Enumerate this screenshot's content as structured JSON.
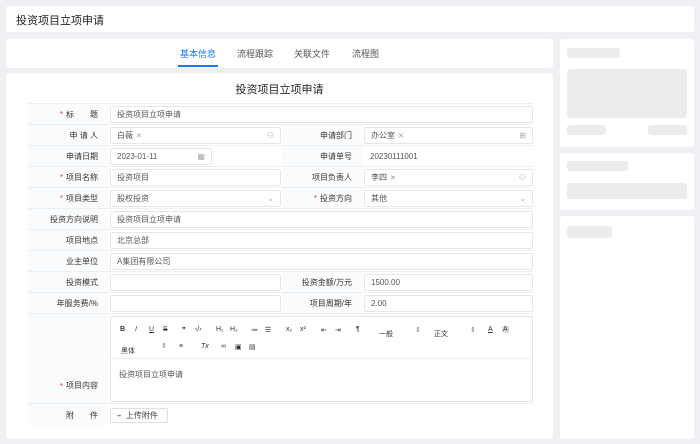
{
  "page": {
    "title": "投资项目立项申请"
  },
  "tabs": [
    {
      "label": "基本信息",
      "active": true
    },
    {
      "label": "流程跟踪",
      "active": false
    },
    {
      "label": "关联文件",
      "active": false
    },
    {
      "label": "流程图",
      "active": false
    }
  ],
  "form": {
    "title": "投资项目立项申请",
    "fields": {
      "title": {
        "label": "标　　题",
        "required": true,
        "value": "投资项目立项申请"
      },
      "applicant": {
        "label": "申 请 人",
        "tag": "白薇"
      },
      "department": {
        "label": "申请部门",
        "tag": "办公室"
      },
      "apply_date": {
        "label": "申请日期",
        "value": "2023-01-11"
      },
      "apply_no": {
        "label": "申请单号",
        "value": "20230111001"
      },
      "project_name": {
        "label": "项目名称",
        "required": true,
        "value": "投资项目"
      },
      "project_owner": {
        "label": "项目负责人",
        "tag": "李四"
      },
      "project_type": {
        "label": "项目类型",
        "required": true,
        "value": "股权投资"
      },
      "invest_direction": {
        "label": "投资方向",
        "required": true,
        "value": "其他"
      },
      "direction_desc": {
        "label": "投资方向说明",
        "value": "投资项目立项申请"
      },
      "location": {
        "label": "项目地点",
        "value": "北京总部"
      },
      "owner_unit": {
        "label": "业主单位",
        "value": "A集团有限公司"
      },
      "invest_mode": {
        "label": "投资模式",
        "value": ""
      },
      "invest_amount": {
        "label": "投资金额/万元",
        "value": "1500.00"
      },
      "service_fee": {
        "label": "年服务费/%",
        "value": ""
      },
      "cycle": {
        "label": "项目周期/年",
        "value": "2.00"
      },
      "content": {
        "label": "项目内容",
        "required": true,
        "value": "投资项目立项申请"
      },
      "attachment": {
        "label": "附　　件",
        "button": "上传附件"
      }
    }
  },
  "editor": {
    "toolbar": {
      "bold": "B",
      "italic": "I",
      "underline": "U",
      "strike": "S",
      "quote": "❞",
      "code": "‹/›",
      "h1": "H₁",
      "h2": "H₂",
      "ol": "≔",
      "ul": "☰",
      "sub": "x₂",
      "sup": "x²",
      "indent_left": "⇤",
      "indent_right": "⇥",
      "direction": "¶",
      "size_select": "一般",
      "style_select": "正文",
      "font_color": "A",
      "bg_color": "A",
      "font_select": "黑体",
      "align": "≡",
      "clear": "Tx",
      "link": "🔗",
      "image": "▣",
      "video": "▤"
    }
  },
  "colors": {
    "accent": "#1677ff",
    "required": "#e0434e"
  }
}
